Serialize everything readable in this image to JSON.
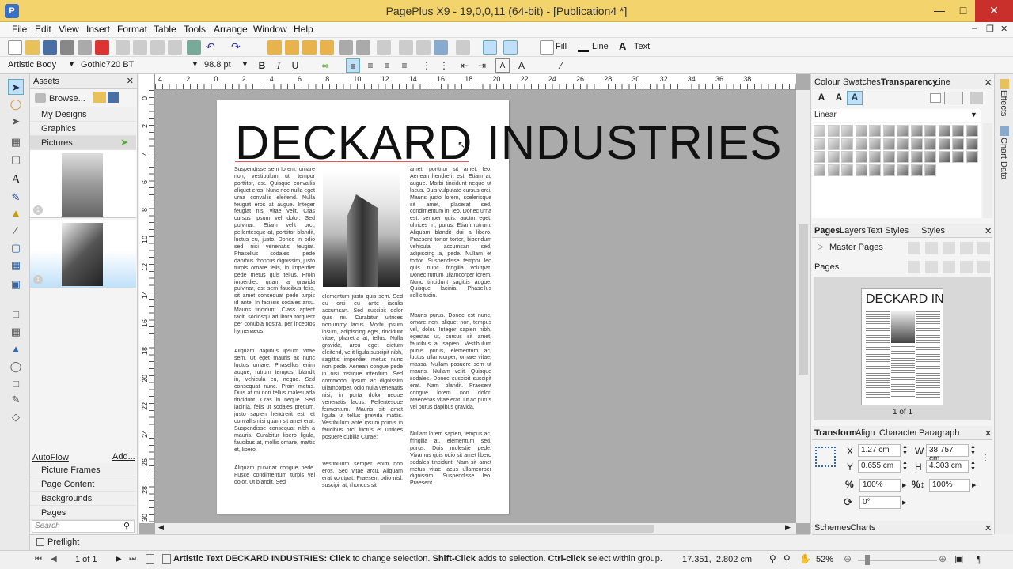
{
  "window": {
    "title": "PagePlus X9 - 19,0,0,11 (64-bit) - [Publication4 *]"
  },
  "menu": [
    "File",
    "Edit",
    "View",
    "Insert",
    "Format",
    "Table",
    "Tools",
    "Arrange",
    "Window",
    "Help"
  ],
  "toolbar": {
    "fill_label": "Fill",
    "line_label": "Line",
    "text_label": "Text"
  },
  "format_bar": {
    "style": "Artistic Body",
    "font": "Gothic720 BT",
    "size": "98.8 pt",
    "bold": "B",
    "italic": "I",
    "underline": "U"
  },
  "ruler": {
    "h_labels": [
      "4",
      "2",
      "0",
      "2",
      "4",
      "6",
      "8",
      "10",
      "12",
      "14",
      "16",
      "18",
      "20",
      "22",
      "24",
      "26",
      "28",
      "30",
      "32",
      "34",
      "36",
      "38"
    ],
    "v_labels": [
      "0",
      "2",
      "4",
      "6",
      "8",
      "10",
      "12",
      "14",
      "16",
      "18",
      "20",
      "22",
      "24",
      "26",
      "28",
      "30"
    ]
  },
  "assets": {
    "title": "Assets",
    "browse": "Browse...",
    "items": [
      "My Designs",
      "Graphics",
      "Pictures"
    ],
    "autoflow": "AutoFlow",
    "add": "Add...",
    "bottom_items": [
      "Picture Frames",
      "Page Content",
      "Backgrounds",
      "Pages"
    ],
    "search_placeholder": "Search",
    "preflight": "Preflight"
  },
  "document": {
    "headline": "DECKARD INDUSTRIES",
    "col1a": "Suspendisse sem lorem, ornare non, vestibulum ut, tempor porttitor, est. Quisque convallis aliquet eros. Nunc nec nulla eget urna convallis eleifend. Nulla feugiat eros at augue. Integer feugiat nisi vitae velit. Cras cursus ipsum vel dolor. Sed pulvinar. Etiam velit orci, pellentesque at, porttitor blandit, luctus eu, justo. Donec in odio sed nisi venenatis feugiat. Phasellus sodales, pede dapibus rhoncus dignissim, justo turpis ornare felis, in imperdiet pede metus quis tellus. Proin imperdiet, quam a gravida pulvinar, est sem faucibus felis, sit amet consequat pede turpis id ante. In facilisis sodales arcu. Mauris tincidunt. Class aptent taciti sociosqu ad litora torquent per conubia nostra, per inceptos hymenaeos.",
    "col1b": "Aliquam dapibus ipsum vitae sem. Ut eget mauris ac nunc luctus ornare. Phasellus enim augue, rutrum tempus, blandit in, vehicula eu, neque. Sed consequat nunc. Proin metus. Duis at mi non tellus malesuada tincidunt. Cras in neque. Sed lacinia, felis ut sodales pretium, justo sapien hendrerit est, et convallis nisi quam sit amet erat. Suspendisse consequat nibh a mauris. Curabitur libero ligula, faucibus at, mollis ornare, mattis et, libero.",
    "col1c": "Aliquam pulvinar congue pede. Fusce condimentum turpis vel dolor. Ut blandit. Sed",
    "col2a": "elementum justo quis sem. Sed eu orci eu ante iaculis accumsan. Sed suscipit dolor quis mi. Curabitur ultrices nonummy lacus. Morbi ipsum ipsum, adipiscing eget, tincidunt vitae, pharetra at, tellus. Nulla gravida, arcu eget dictum eleifend, velit ligula suscipit nibh, sagittis imperdiet metus nunc non pede. Aenean congue pede in nisi tristique interdum. Sed commodo, ipsum ac dignissim ullamcorper, odio nulla venenatis nisi, in porta dolor neque venenatis lacus. Pellentesque fermentum. Mauris sit amet ligula ut tellus gravida mattis. Vestibulum ante ipsum primis in faucibus orci luctus et ultrices posuere cubilia Curae;",
    "col2b": "Vestibulum semper enim non eros. Sed vitae arcu. Aliquam erat volutpat. Praesent odio nisl, suscipit at, rhoncus sit",
    "col3a": "amet, porttitor sit amet, leo. Aenean hendrerit est. Etiam ac augue. Morbi tincidunt neque ut lacus. Duis vulputate cursus orci. Mauris justo lorem, scelerisque sit amet, placerat sed, condimentum in, leo. Donec urna est, semper quis, auctor eget, ultrices in, purus. Etiam rutrum. Aliquam blandit dui a libero. Praesent tortor tortor, bibendum vehicula, accumsan sed, adipiscing a, pede. Nullam et tortor. Suspendisse tempor leo quis nunc fringilla volutpat. Donec rutrum ullamcorper lorem. Nunc tincidunt sagittis augue. Quisque lacinia. Phasellus sollicitudin.",
    "col3b": "Mauris purus. Donec est nunc, ornare non, aliquet non, tempus vel, dolor. Integer sapien nibh, egestas ut, cursus sit amet, faucibus a, sapien. Vestibulum purus purus, elementum ac, luctus ullamcorper, ornare vitae, massa. Nullam posuere sem ut mauris. Nullam velit. Quisque sodales. Donec suscipit suscipit erat. Nam blandit. Praesent congue lorem non dolor. Maecenas vitae erat. Ut ac purus vel purus dapibus gravida.",
    "col3c": "Nullam lorem sapien, tempus ac, fringilla at, elementum sed, purus. Duis molestie pede. Vivamus quis odio sit amet libero sodales tincidunt. Nam sit amet metus vitae lacus ullamcorper dignissim. Suspendisse leo. Praesent"
  },
  "right_panel": {
    "top_tabs": [
      "Colour",
      "Swatches",
      "Transparency",
      "Line"
    ],
    "gradient_type": "Linear",
    "pages_tabs": [
      "Pages",
      "Layers",
      "Text Styles",
      "Styles"
    ],
    "master_pages": "Master Pages",
    "pages_label": "Pages",
    "thumb_headline": "DECKARD IN",
    "page_count": "1 of 1",
    "transform_tabs": [
      "Transform",
      "Align",
      "Character",
      "Paragraph"
    ],
    "x_label": "X",
    "x_value": "1.27 cm",
    "y_label": "Y",
    "y_value": "0.655 cm",
    "w_label": "W",
    "w_value": "38.757 cm",
    "h_label": "H",
    "h_value": "4.303 cm",
    "scale_x": "100%",
    "scale_y": "100%",
    "rotation": "0°",
    "bottom_tabs": [
      "Schemes",
      "Charts"
    ]
  },
  "side_tabs": [
    "Effects",
    "Chart Data"
  ],
  "status": {
    "page": "1 of 1",
    "message_bold": "Artistic Text DECKARD INDUSTRIES:",
    "message_click": "Click",
    "message_mid": "to change selection.",
    "message_shift": "Shift-Click",
    "message_mid2": "adds to selection.",
    "message_ctrl": "Ctrl-click",
    "message_end": "select within group.",
    "coords": "17.351,  2.802 cm",
    "zoom": "52%"
  }
}
